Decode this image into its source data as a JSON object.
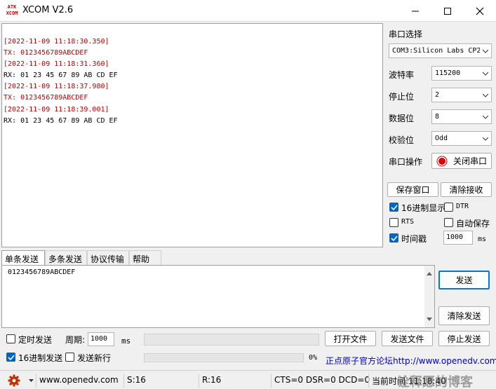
{
  "window": {
    "logo_top": "ATK",
    "logo_bottom": "XCOM",
    "title": "XCOM V2.6"
  },
  "receive": {
    "lines": [
      {
        "kind": "ts",
        "text": "[2022-11-09 11:18:30.350]"
      },
      {
        "kind": "tx",
        "text": "TX: 0123456789ABCDEF"
      },
      {
        "kind": "ts",
        "text": "[2022-11-09 11:18:31.360]"
      },
      {
        "kind": "rx",
        "text": "RX: 01 23 45 67 89 AB CD EF"
      },
      {
        "kind": "ts",
        "text": "[2022-11-09 11:18:37.980]"
      },
      {
        "kind": "tx",
        "text": "TX: 0123456789ABCDEF"
      },
      {
        "kind": "ts",
        "text": "[2022-11-09 11:18:39.001]"
      },
      {
        "kind": "rx",
        "text": "RX: 01 23 45 67 89 AB CD EF"
      }
    ],
    "colors": {
      "timestamp": "#c00000",
      "tx": "#c00000",
      "rx": "#000000"
    }
  },
  "settings": {
    "port_select_label": "串口选择",
    "port_value": "COM3:Silicon Labs CP2",
    "baud_label": "波特率",
    "baud_value": "115200",
    "stopbits_label": "停止位",
    "stopbits_value": "2",
    "databits_label": "数据位",
    "databits_value": "8",
    "parity_label": "校验位",
    "parity_value": "Odd",
    "operation_label": "串口操作",
    "close_port_label": "关闭串口",
    "save_window_label": "保存窗口",
    "clear_receive_label": "清除接收",
    "hex_display_label": "16进制显示",
    "hex_display_checked": true,
    "dtr_label": "DTR",
    "dtr_checked": false,
    "rts_label": "RTS",
    "rts_checked": false,
    "auto_save_label": "自动保存",
    "auto_save_checked": false,
    "timestamp_label": "时间戳",
    "timestamp_checked": true,
    "timestamp_value": "1000",
    "timestamp_unit": "ms"
  },
  "tabs": [
    {
      "label": "单条发送",
      "active": true
    },
    {
      "label": "多条发送",
      "active": false
    },
    {
      "label": "协议传输",
      "active": false
    },
    {
      "label": "帮助",
      "active": false
    }
  ],
  "send": {
    "text": "0123456789ABCDEF",
    "send_label": "发送",
    "clear_send_label": "清除发送",
    "timed_send_label": "定时发送",
    "timed_send_checked": false,
    "period_label": "周期:",
    "period_value": "1000",
    "period_unit": "ms",
    "open_file_label": "打开文件",
    "send_file_label": "发送文件",
    "stop_send_label": "停止发送",
    "hex_send_label": "16进制发送",
    "hex_send_checked": true,
    "newline_label": "发送新行",
    "newline_checked": false,
    "progress_percent": "0%",
    "forum_link": "正点原子官方论坛http://www.openedv.com/"
  },
  "status": {
    "url": "www.openedv.com",
    "sent": "S:16",
    "received": "R:16",
    "signals": "CTS=0 DSR=0 DCD=0",
    "time": "当前时间 11:18:40",
    "watermark": "诠释愿的博客"
  },
  "colors": {
    "accent": "#0067c0",
    "focus": "#0078d7",
    "record_red": "#e00000",
    "link": "#0000c0",
    "gear": "#c03000"
  }
}
